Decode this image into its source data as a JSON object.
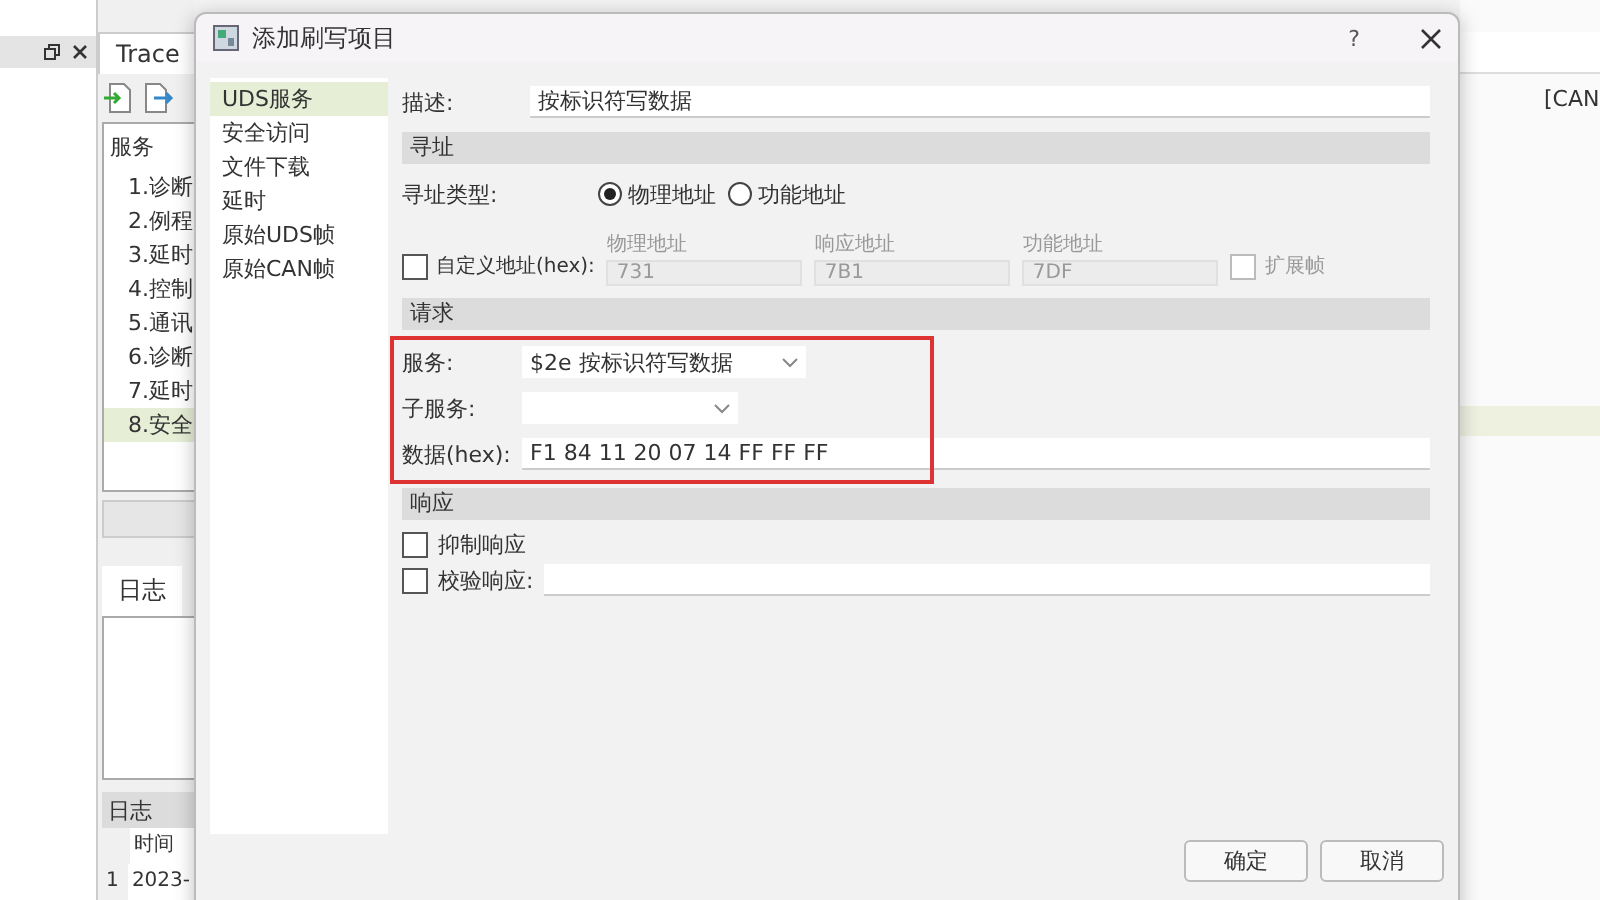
{
  "background": {
    "tab": "Trace",
    "services": {
      "header": "服务",
      "items": [
        {
          "label": "1.诊断",
          "selected": false
        },
        {
          "label": "2.例程",
          "selected": false
        },
        {
          "label": "3.延时",
          "selected": false
        },
        {
          "label": "4.控制",
          "selected": false
        },
        {
          "label": "5.通讯",
          "selected": false
        },
        {
          "label": "6.诊断",
          "selected": false
        },
        {
          "label": "7.延时",
          "selected": false
        },
        {
          "label": "8.安全",
          "selected": true
        }
      ]
    },
    "log_tab": "日志",
    "log": {
      "title": "日志",
      "columns": [
        "",
        "时间"
      ],
      "rows": [
        [
          "1",
          "2023-"
        ]
      ]
    },
    "right_text": "[CAN"
  },
  "dialog": {
    "title": "添加刷写项目",
    "help": "?",
    "nav": [
      {
        "label": "UDS服务",
        "selected": true
      },
      {
        "label": "安全访问",
        "selected": false
      },
      {
        "label": "文件下载",
        "selected": false
      },
      {
        "label": "延时",
        "selected": false
      },
      {
        "label": "原始UDS帧",
        "selected": false
      },
      {
        "label": "原始CAN帧",
        "selected": false
      }
    ],
    "description": {
      "label": "描述:",
      "value": "按标识符写数据"
    },
    "addressing": {
      "heading": "寻址",
      "type_label": "寻址类型:",
      "types": [
        {
          "label": "物理地址",
          "selected": true
        },
        {
          "label": "功能地址",
          "selected": false
        }
      ],
      "custom": {
        "label": "自定义地址(hex):",
        "checked": false
      },
      "addresses": [
        {
          "label": "物理地址",
          "value": "731",
          "disabled": true
        },
        {
          "label": "响应地址",
          "value": "7B1",
          "disabled": true
        },
        {
          "label": "功能地址",
          "value": "7DF",
          "disabled": true
        }
      ],
      "extended": {
        "label": "扩展帧",
        "checked": false,
        "disabled": true
      }
    },
    "request": {
      "heading": "请求",
      "highlighted": true,
      "service": {
        "label": "服务:",
        "value": "$2e 按标识符写数据"
      },
      "subservice": {
        "label": "子服务:"
      },
      "data": {
        "label": "数据(hex):",
        "value": "F1 84 11 20 07 14 FF FF FF"
      }
    },
    "response": {
      "heading": "响应",
      "suppress": {
        "label": "抑制响应",
        "checked": false
      },
      "verify": {
        "label": "校验响应:",
        "checked": false
      }
    },
    "buttons": [
      {
        "label": "确定"
      },
      {
        "label": "取消"
      }
    ]
  }
}
